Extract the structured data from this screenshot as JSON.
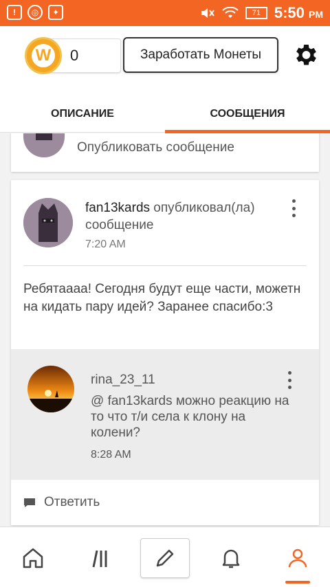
{
  "status_bar": {
    "time": "5:50",
    "ampm": "PM",
    "battery": "71",
    "icons": [
      "alert-icon",
      "chrome-icon",
      "app-icon",
      "mute-icon",
      "wifi-icon",
      "battery-icon"
    ]
  },
  "header": {
    "coin_count": "0",
    "coin_letter": "W",
    "earn_button": "Заработать Монеты",
    "tabs": [
      {
        "label": "ОПИСАНИЕ",
        "active": false
      },
      {
        "label": "СООБЩЕНИЯ",
        "active": true
      }
    ]
  },
  "compose": {
    "placeholder": "Опубликовать сообщение"
  },
  "post": {
    "author": "fan13kards",
    "action": " опубликовал(ла) сообщение",
    "time": "7:20 AM",
    "text": "Ребятаааа! Сегодня будут еще части, можетн на кидать пару идей? Заранее спасибо:3",
    "reply": {
      "author": "rina_23_11",
      "text": "@ fan13kards  можно реакцию на то что т/и села к клону на колени?",
      "time": "8:28 AM"
    },
    "answer_label": "Ответить"
  },
  "colors": {
    "accent": "#f26522",
    "coin": "#f5a623"
  },
  "bottom_nav": {
    "items": [
      "home-icon",
      "library-icon",
      "write-icon",
      "notifications-icon",
      "profile-icon"
    ],
    "active": "profile-icon"
  }
}
